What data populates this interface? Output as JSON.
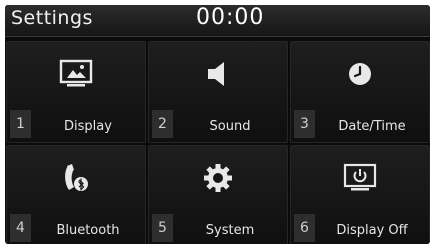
{
  "header": {
    "title": "Settings",
    "time": "00:00"
  },
  "menu": [
    {
      "number": "1",
      "label": "Display",
      "icon": "monitor-image-icon"
    },
    {
      "number": "2",
      "label": "Sound",
      "icon": "speaker-icon"
    },
    {
      "number": "3",
      "label": "Date/Time",
      "icon": "clock-icon"
    },
    {
      "number": "4",
      "label": "Bluetooth",
      "icon": "bluetooth-phone-icon"
    },
    {
      "number": "5",
      "label": "System",
      "icon": "gear-icon"
    },
    {
      "number": "6",
      "label": "Display Off",
      "icon": "monitor-power-icon"
    }
  ]
}
